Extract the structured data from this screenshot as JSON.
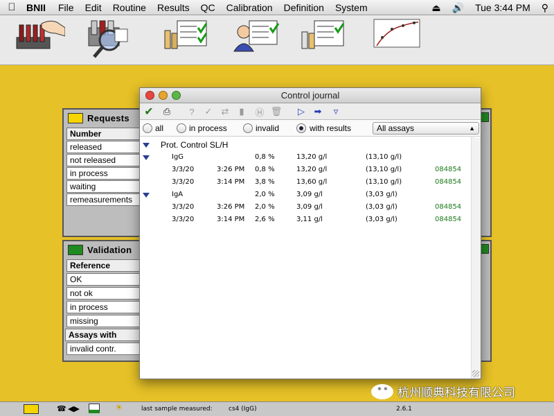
{
  "menubar": {
    "app": "BNII",
    "menus": [
      "File",
      "Edit",
      "Routine",
      "Results",
      "QC",
      "Calibration",
      "Definition",
      "System"
    ],
    "clock": "Tue 3:44 PM"
  },
  "toolbar_icons": [
    "sample-rack-icon",
    "reagent-inspect-icon",
    "tube-checklist-icon",
    "operator-checklist-icon",
    "control-checklist-icon",
    "calibration-curve-icon"
  ],
  "requests_panel": {
    "title": "Requests",
    "color": "#f5d400",
    "rows": [
      "Number",
      "released",
      "not released",
      "in process",
      "waiting",
      "remeasurements"
    ]
  },
  "validation_panel": {
    "title": "Validation",
    "color": "#1f8a1f",
    "rows": [
      "Reference",
      "OK",
      "not ok",
      "in process",
      "missing",
      "Assays with",
      "invalid contr."
    ]
  },
  "window": {
    "title": "Control journal",
    "filters": [
      {
        "label": "all",
        "selected": false
      },
      {
        "label": "in process",
        "selected": false
      },
      {
        "label": "invalid",
        "selected": false
      },
      {
        "label": "with results",
        "selected": true
      }
    ],
    "assay_select": "All assays",
    "group": "Prot. Control SL/H",
    "assays": [
      {
        "name": "IgG",
        "cv": "0,8 %",
        "mean": "13,20 g/l",
        "target": "(13,10 g/l)",
        "entries": [
          {
            "date": "3/3/20",
            "time": "3:26 PM",
            "cv": "0,8 %",
            "value": "13,20 g/l",
            "target": "(13,10 g/l)",
            "lot": "084854"
          },
          {
            "date": "3/3/20",
            "time": "3:14 PM",
            "cv": "3,8 %",
            "value": "13,60 g/l",
            "target": "(13,10 g/l)",
            "lot": "084854"
          }
        ]
      },
      {
        "name": "IgA",
        "cv": "2,0 %",
        "mean": "3,09 g/l",
        "target": "(3,03 g/l)",
        "entries": [
          {
            "date": "3/3/20",
            "time": "3:26 PM",
            "cv": "2,0 %",
            "value": "3,09 g/l",
            "target": "(3,03 g/l)",
            "lot": "084854"
          },
          {
            "date": "3/3/20",
            "time": "3:14 PM",
            "cv": "2,6 %",
            "value": "3,11 g/l",
            "target": "(3,03 g/l)",
            "lot": "084854"
          }
        ]
      }
    ]
  },
  "statusbar": {
    "label": "last sample measured:",
    "sample": "cs4 (IgG)",
    "version": "2.6.1"
  },
  "watermark": "杭州顺典科技有限公司"
}
